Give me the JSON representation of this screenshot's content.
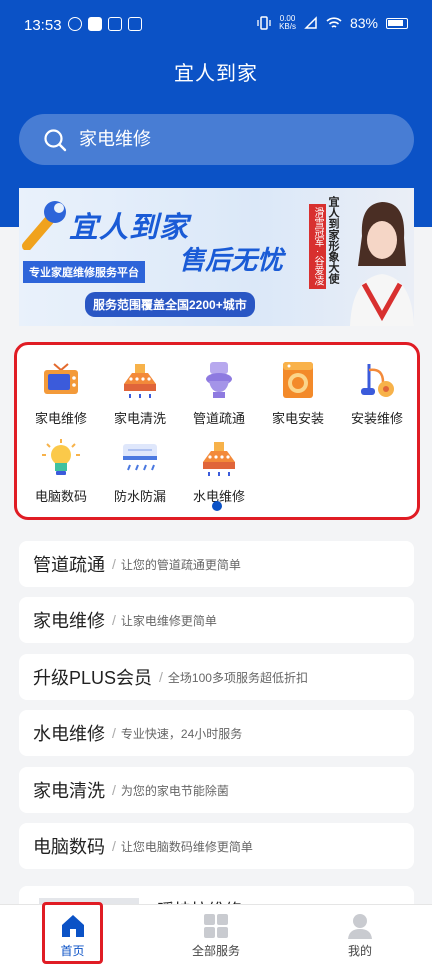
{
  "status_bar": {
    "time": "13:53",
    "net_speed_value": "0.00",
    "net_speed_unit": "KB/s",
    "battery": "83%"
  },
  "header": {
    "title": "宜人到家"
  },
  "search": {
    "placeholder": "家电维修"
  },
  "banner": {
    "brand": "宜人到家",
    "slogan": "售后无忧",
    "tagline": "专业家庭维修服务平台",
    "coverage": "服务范围覆盖全国2200+城市",
    "ambassador": "宜人到家形象大使",
    "honor": "滑雪冠军 · 谷爱凌"
  },
  "categories": [
    {
      "label": "家电维修",
      "icon": "tv-icon"
    },
    {
      "label": "家电清洗",
      "icon": "range-hood-icon"
    },
    {
      "label": "管道疏通",
      "icon": "toilet-icon"
    },
    {
      "label": "家电安装",
      "icon": "washing-machine-icon"
    },
    {
      "label": "安装维修",
      "icon": "vacuum-icon"
    },
    {
      "label": "电脑数码",
      "icon": "lightbulb-icon"
    },
    {
      "label": "防水防漏",
      "icon": "air-conditioner-icon"
    },
    {
      "label": "水电维修",
      "icon": "range-hood-icon"
    }
  ],
  "services": [
    {
      "name": "管道疏通",
      "desc": "让您的管道疏通更简单"
    },
    {
      "name": "家电维修",
      "desc": "让家电维修更简单"
    },
    {
      "name": "升级PLUS会员",
      "desc": "全场100多项服务超低折扣"
    },
    {
      "name": "水电维修",
      "desc": "专业快速，24小时服务"
    },
    {
      "name": "家电清洗",
      "desc": "为您的家电节能除菌"
    },
    {
      "name": "电脑数码",
      "desc": "让您电脑数码维修更简单"
    }
  ],
  "partial_item": {
    "title": "暖挂拉维修"
  },
  "tab_bar": {
    "tabs": [
      {
        "label": "首页",
        "icon": "home-icon",
        "active": true
      },
      {
        "label": "全部服务",
        "icon": "grid-icon",
        "active": false
      },
      {
        "label": "我的",
        "icon": "user-icon",
        "active": false
      }
    ]
  },
  "colors": {
    "primary": "#0b52c6",
    "highlight_border": "#e01c24",
    "background": "#f3f4f6"
  }
}
